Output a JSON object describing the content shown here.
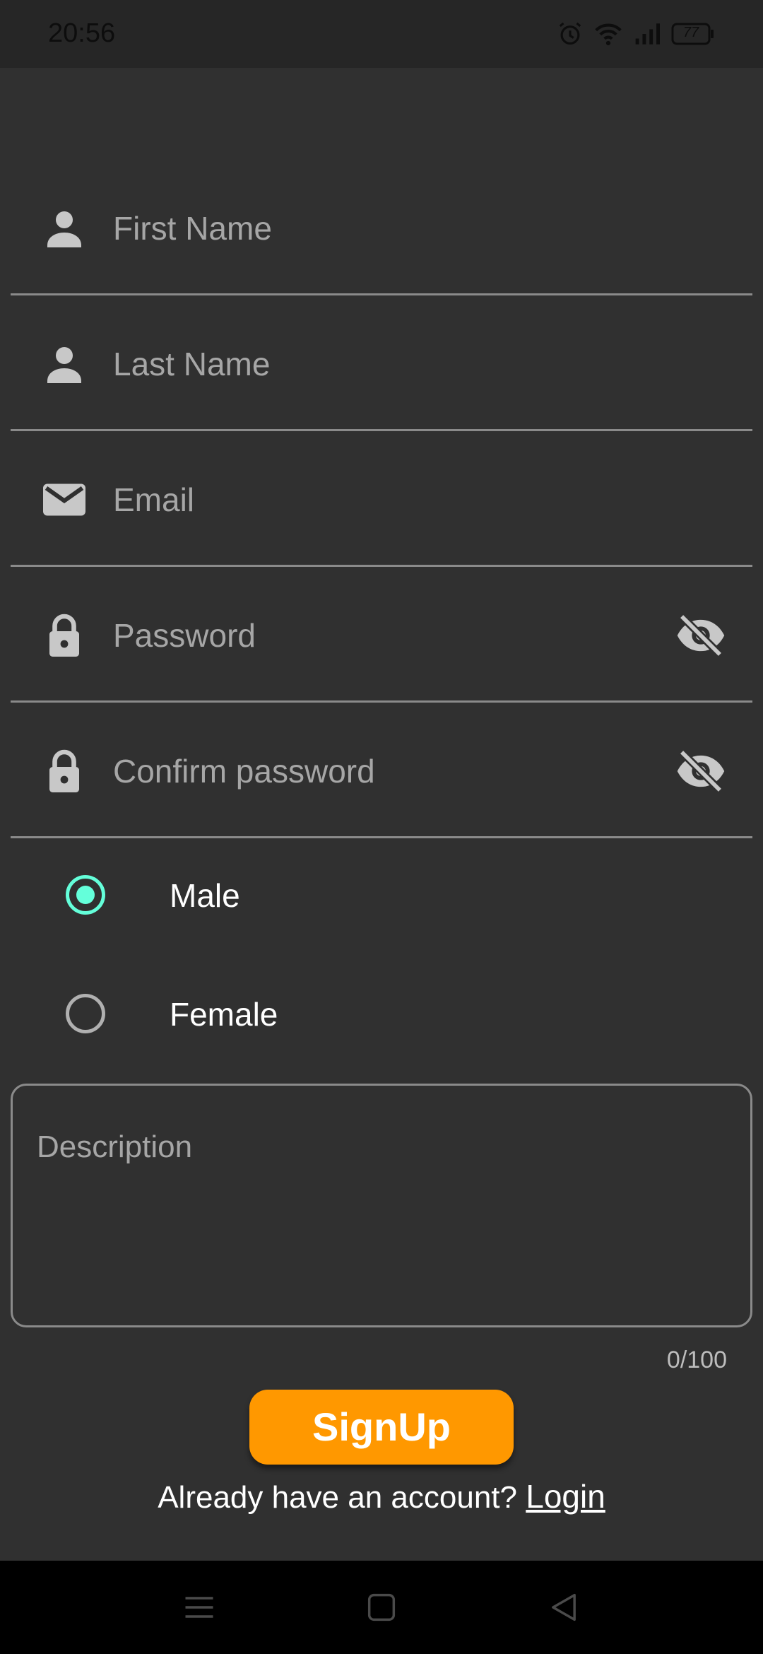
{
  "status_bar": {
    "time": "20:56",
    "battery": "77",
    "icons": [
      "alarm-icon",
      "wifi-icon",
      "signal-icon",
      "battery-icon"
    ]
  },
  "form": {
    "first_name": {
      "placeholder": "First Name",
      "icon": "person-icon"
    },
    "last_name": {
      "placeholder": "Last Name",
      "icon": "person-icon"
    },
    "email": {
      "placeholder": "Email",
      "icon": "mail-icon"
    },
    "password": {
      "placeholder": "Password",
      "icon": "lock-icon",
      "toggle_icon": "visibility-off-icon"
    },
    "confirm_password": {
      "placeholder": "Confirm password",
      "icon": "lock-icon",
      "toggle_icon": "visibility-off-icon"
    },
    "gender": {
      "options": [
        {
          "label": "Male",
          "selected": true
        },
        {
          "label": "Female",
          "selected": false
        }
      ]
    },
    "description": {
      "placeholder": "Description",
      "counter": "0/100"
    }
  },
  "actions": {
    "signup_label": "SignUp",
    "login_prompt": "Already have an account?",
    "login_link": "Login"
  },
  "colors": {
    "background": "#303030",
    "accent": "#64ffda",
    "button": "#ff9800",
    "placeholder": "#a6a6a6",
    "divider": "#8a8a8a"
  },
  "nav_bar": {
    "buttons": [
      "menu-icon",
      "home-icon",
      "back-icon"
    ]
  }
}
